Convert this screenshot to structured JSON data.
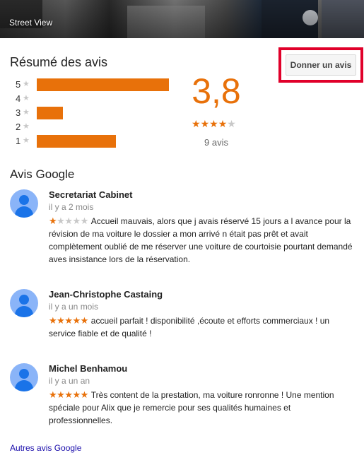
{
  "banner": {
    "label": "Street View"
  },
  "summary": {
    "title": "Résumé des avis",
    "write_review_label": "Donner un avis",
    "rating": "3,8",
    "rating_value": 3.8,
    "count": "9 avis",
    "histogram": [
      {
        "stars": "5",
        "fraction": 1.0
      },
      {
        "stars": "4",
        "fraction": 0.0
      },
      {
        "stars": "3",
        "fraction": 0.2
      },
      {
        "stars": "2",
        "fraction": 0.0
      },
      {
        "stars": "1",
        "fraction": 0.6
      }
    ]
  },
  "reviews_section": {
    "title": "Avis Google"
  },
  "reviews": [
    {
      "author": "Secretariat Cabinet",
      "date": "il y a 2 mois",
      "stars": 1,
      "text": "Accueil mauvais, alors que j avais réservé 15 jours a l avance pour la révision de ma voiture le dossier a mon arrivé n était pas prêt et avait complètement oublié de me réserver une voiture de courtoisie pourtant demandé aves insistance lors de la réservation."
    },
    {
      "author": "Jean-Christophe Castaing",
      "date": "il y a un mois",
      "stars": 5,
      "text": "accueil parfait ! disponibilité ,écoute et efforts commerciaux ! un service fiable et de qualité !"
    },
    {
      "author": "Michel Benhamou",
      "date": "il y a un an",
      "stars": 5,
      "text": "Très content de la prestation, ma voiture ronronne ! Une mention spéciale pour Alix que je remercie pour ses qualités humaines et professionnelles."
    }
  ],
  "more_link": "Autres avis Google",
  "colors": {
    "accent": "#e8710a",
    "highlight": "#e0002a",
    "link": "#1a0dab",
    "avatar": "#8ab4f8"
  },
  "icons": {
    "star": "star-icon",
    "avatar": "person-icon"
  }
}
